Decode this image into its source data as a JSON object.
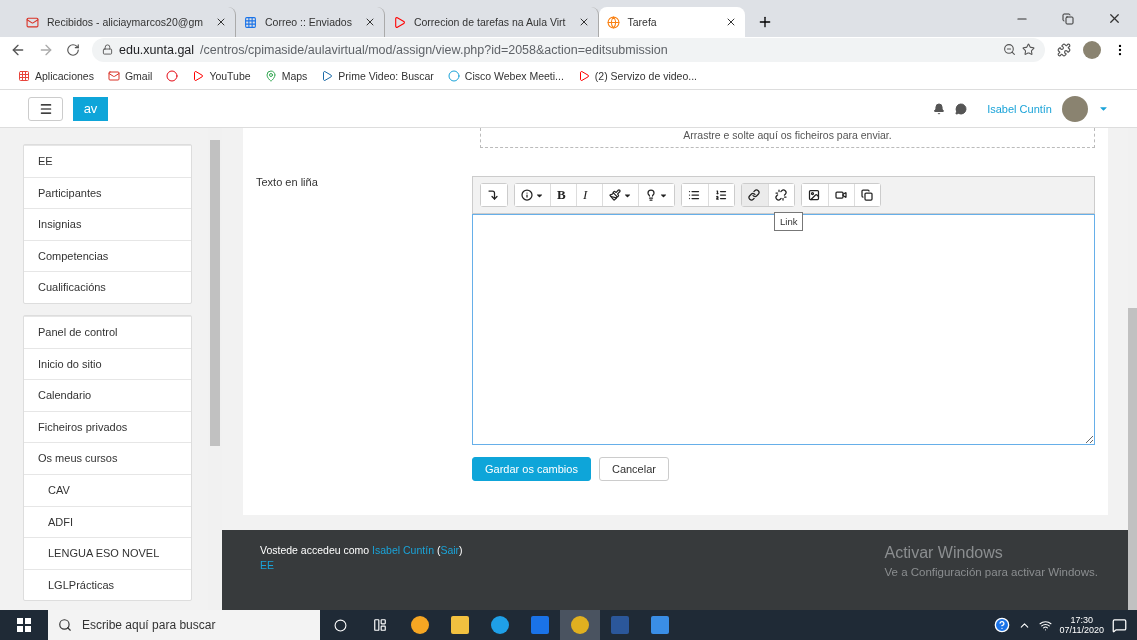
{
  "browser": {
    "tabs": [
      {
        "title": "Recibidos - aliciaymarcos20@gm",
        "selected": false
      },
      {
        "title": "Correo :: Enviados",
        "selected": false
      },
      {
        "title": "Correcion de tarefas na Aula Virt",
        "selected": false
      },
      {
        "title": "Tarefa",
        "selected": true
      }
    ],
    "address": {
      "domain": "edu.xunta.gal",
      "path": "/centros/cpimaside/aulavirtual/mod/assign/view.php?id=2058&action=editsubmission"
    },
    "bookmarks": [
      {
        "label": "Aplicaciones"
      },
      {
        "label": "Gmail"
      },
      {
        "kind": "icon"
      },
      {
        "label": "YouTube"
      },
      {
        "label": "Maps"
      },
      {
        "label": "Prime Video: Buscar"
      },
      {
        "label": "Cisco Webex Meeti..."
      },
      {
        "label": "(2) Servizo de video..."
      }
    ]
  },
  "navbar": {
    "brand": "av",
    "user_name": "Isabel Cuntín"
  },
  "sidebar": {
    "groups": [
      [
        {
          "label": "EE"
        },
        {
          "label": "Participantes"
        },
        {
          "label": "Insignias"
        },
        {
          "label": "Competencias"
        },
        {
          "label": "Cualificacións"
        }
      ],
      [
        {
          "label": "Panel de control"
        },
        {
          "label": "Inicio do sitio"
        },
        {
          "label": "Calendario"
        },
        {
          "label": "Ficheiros privados"
        },
        {
          "label": "Os meus cursos",
          "children": [
            {
              "label": "CAV"
            },
            {
              "label": "ADFI"
            },
            {
              "label": "LENGUA ESO NOVEL"
            },
            {
              "label": "LGLPrácticas"
            }
          ]
        }
      ]
    ]
  },
  "form": {
    "dropzone_text": "Arrastre e solte aquí os ficheiros para enviar.",
    "field_label": "Texto en liña",
    "toolbar": [
      [
        {
          "kind": "icon",
          "dropdown": false
        }
      ],
      [
        {
          "kind": "icon",
          "dropdown": true
        },
        {
          "kind": "text",
          "label": "B",
          "dropdown": false
        },
        {
          "kind": "text",
          "label": "I",
          "dropdown": false
        },
        {
          "kind": "icon",
          "dropdown": true
        },
        {
          "kind": "icon",
          "dropdown": true
        }
      ],
      [
        {
          "kind": "icon",
          "dropdown": false
        },
        {
          "kind": "icon",
          "dropdown": false
        }
      ],
      [
        {
          "kind": "icon",
          "dropdown": false,
          "tooltip": "Link"
        },
        {
          "kind": "icon",
          "dropdown": false
        }
      ],
      [
        {
          "kind": "icon",
          "dropdown": false
        },
        {
          "kind": "icon",
          "dropdown": false
        },
        {
          "kind": "icon",
          "dropdown": false
        }
      ]
    ],
    "buttons": [
      {
        "label": "Gardar os cambios",
        "kind": "primary"
      },
      {
        "label": "Cancelar",
        "kind": "secondary"
      }
    ]
  },
  "footer": {
    "prefix": "Vostede accedeu como",
    "user": "Isabel Cuntín",
    "paren_open": "(",
    "logout": "Sair",
    "paren_close": ")",
    "course": "EE"
  },
  "activation": {
    "title": "Activar Windows",
    "subtitle": "Ve a Configuración para activar Windows."
  },
  "taskbar": {
    "search_placeholder": "Escribe aquí para buscar",
    "time": "17:30",
    "date": "07/11/2020"
  }
}
